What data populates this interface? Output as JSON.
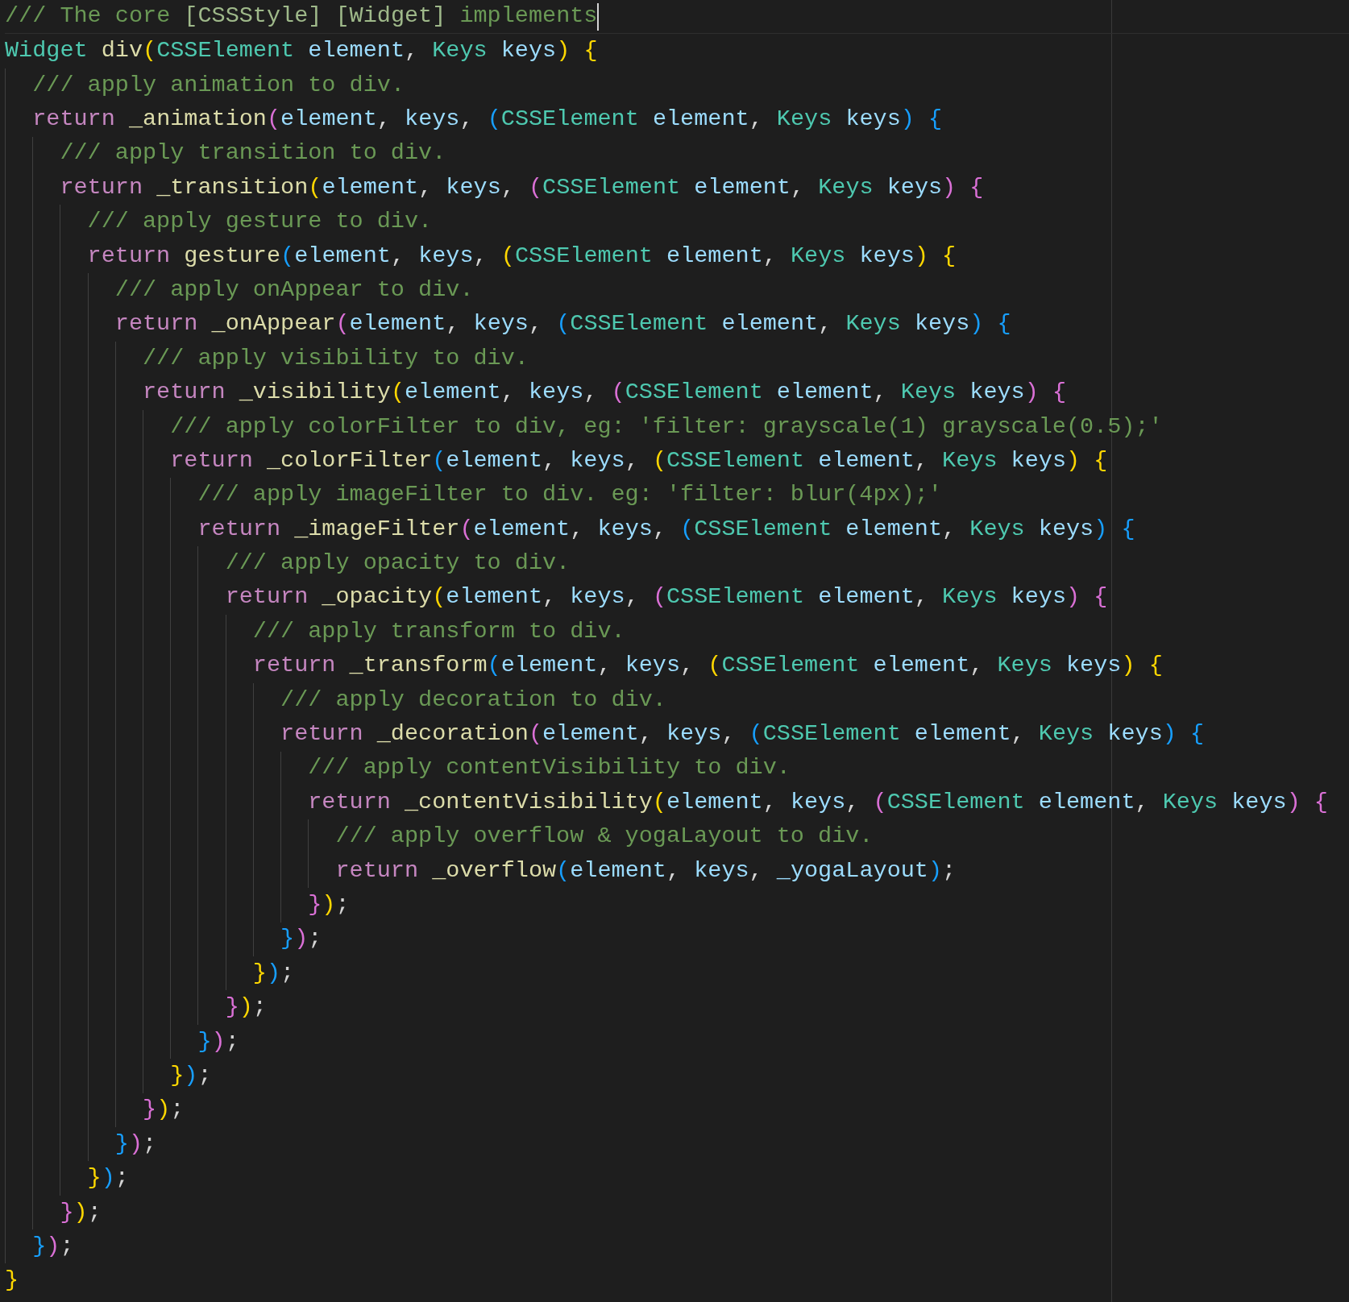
{
  "editor": {
    "lines": [
      {
        "cursor": true,
        "tokens": [
          {
            "text": "/// The core ",
            "kind": "comment"
          },
          {
            "text": "[CSSStyle]",
            "kind": "docref"
          },
          {
            "text": " [Widget]",
            "kind": "docref"
          },
          {
            "text": " implements",
            "kind": "comment"
          }
        ]
      },
      {
        "cursor": false,
        "tokens": [
          {
            "text": "Widget ",
            "kind": "type"
          },
          {
            "text": "div",
            "kind": "fn"
          },
          {
            "text": "(",
            "kind": "b0"
          },
          {
            "text": "CSSElement",
            "kind": "type"
          },
          {
            "text": " element",
            "kind": "var"
          },
          {
            "text": ", ",
            "kind": "punct"
          },
          {
            "text": "Keys",
            "kind": "type"
          },
          {
            "text": " keys",
            "kind": "var"
          },
          {
            "text": ")",
            "kind": "b0"
          },
          {
            "text": " {",
            "kind": "b0"
          }
        ]
      },
      {
        "cursor": false,
        "tokens": [
          {
            "text": "  /// apply animation to div.",
            "kind": "comment"
          }
        ]
      },
      {
        "cursor": false,
        "tokens": [
          {
            "text": "  return ",
            "kind": "keyword"
          },
          {
            "text": "_animation",
            "kind": "fn"
          },
          {
            "text": "(",
            "kind": "b1"
          },
          {
            "text": "element",
            "kind": "var"
          },
          {
            "text": ", ",
            "kind": "punct"
          },
          {
            "text": "keys",
            "kind": "var"
          },
          {
            "text": ", ",
            "kind": "punct"
          },
          {
            "text": "(",
            "kind": "b2"
          },
          {
            "text": "CSSElement",
            "kind": "type"
          },
          {
            "text": " element",
            "kind": "var"
          },
          {
            "text": ", ",
            "kind": "punct"
          },
          {
            "text": "Keys",
            "kind": "type"
          },
          {
            "text": " keys",
            "kind": "var"
          },
          {
            "text": ")",
            "kind": "b2"
          },
          {
            "text": " {",
            "kind": "b2"
          }
        ]
      },
      {
        "cursor": false,
        "tokens": [
          {
            "text": "    /// apply transition to div.",
            "kind": "comment"
          }
        ]
      },
      {
        "cursor": false,
        "tokens": [
          {
            "text": "    return ",
            "kind": "keyword"
          },
          {
            "text": "_transition",
            "kind": "fn"
          },
          {
            "text": "(",
            "kind": "b0"
          },
          {
            "text": "element",
            "kind": "var"
          },
          {
            "text": ", ",
            "kind": "punct"
          },
          {
            "text": "keys",
            "kind": "var"
          },
          {
            "text": ", ",
            "kind": "punct"
          },
          {
            "text": "(",
            "kind": "b1"
          },
          {
            "text": "CSSElement",
            "kind": "type"
          },
          {
            "text": " element",
            "kind": "var"
          },
          {
            "text": ", ",
            "kind": "punct"
          },
          {
            "text": "Keys",
            "kind": "type"
          },
          {
            "text": " keys",
            "kind": "var"
          },
          {
            "text": ")",
            "kind": "b1"
          },
          {
            "text": " {",
            "kind": "b1"
          }
        ]
      },
      {
        "cursor": false,
        "tokens": [
          {
            "text": "      /// apply gesture to div.",
            "kind": "comment"
          }
        ]
      },
      {
        "cursor": false,
        "tokens": [
          {
            "text": "      return ",
            "kind": "keyword"
          },
          {
            "text": "gesture",
            "kind": "fn"
          },
          {
            "text": "(",
            "kind": "b2"
          },
          {
            "text": "element",
            "kind": "var"
          },
          {
            "text": ", ",
            "kind": "punct"
          },
          {
            "text": "keys",
            "kind": "var"
          },
          {
            "text": ", ",
            "kind": "punct"
          },
          {
            "text": "(",
            "kind": "b0"
          },
          {
            "text": "CSSElement",
            "kind": "type"
          },
          {
            "text": " element",
            "kind": "var"
          },
          {
            "text": ", ",
            "kind": "punct"
          },
          {
            "text": "Keys",
            "kind": "type"
          },
          {
            "text": " keys",
            "kind": "var"
          },
          {
            "text": ")",
            "kind": "b0"
          },
          {
            "text": " {",
            "kind": "b0"
          }
        ]
      },
      {
        "cursor": false,
        "tokens": [
          {
            "text": "        /// apply onAppear to div.",
            "kind": "comment"
          }
        ]
      },
      {
        "cursor": false,
        "tokens": [
          {
            "text": "        return ",
            "kind": "keyword"
          },
          {
            "text": "_onAppear",
            "kind": "fn"
          },
          {
            "text": "(",
            "kind": "b1"
          },
          {
            "text": "element",
            "kind": "var"
          },
          {
            "text": ", ",
            "kind": "punct"
          },
          {
            "text": "keys",
            "kind": "var"
          },
          {
            "text": ", ",
            "kind": "punct"
          },
          {
            "text": "(",
            "kind": "b2"
          },
          {
            "text": "CSSElement",
            "kind": "type"
          },
          {
            "text": " element",
            "kind": "var"
          },
          {
            "text": ", ",
            "kind": "punct"
          },
          {
            "text": "Keys",
            "kind": "type"
          },
          {
            "text": " keys",
            "kind": "var"
          },
          {
            "text": ")",
            "kind": "b2"
          },
          {
            "text": " {",
            "kind": "b2"
          }
        ]
      },
      {
        "cursor": false,
        "tokens": [
          {
            "text": "          /// apply visibility to div.",
            "kind": "comment"
          }
        ]
      },
      {
        "cursor": false,
        "tokens": [
          {
            "text": "          return ",
            "kind": "keyword"
          },
          {
            "text": "_visibility",
            "kind": "fn"
          },
          {
            "text": "(",
            "kind": "b0"
          },
          {
            "text": "element",
            "kind": "var"
          },
          {
            "text": ", ",
            "kind": "punct"
          },
          {
            "text": "keys",
            "kind": "var"
          },
          {
            "text": ", ",
            "kind": "punct"
          },
          {
            "text": "(",
            "kind": "b1"
          },
          {
            "text": "CSSElement",
            "kind": "type"
          },
          {
            "text": " element",
            "kind": "var"
          },
          {
            "text": ", ",
            "kind": "punct"
          },
          {
            "text": "Keys",
            "kind": "type"
          },
          {
            "text": " keys",
            "kind": "var"
          },
          {
            "text": ")",
            "kind": "b1"
          },
          {
            "text": " {",
            "kind": "b1"
          }
        ]
      },
      {
        "cursor": false,
        "tokens": [
          {
            "text": "            /// apply colorFilter to div, eg: 'filter: grayscale(1) grayscale(0.5);'",
            "kind": "comment"
          }
        ]
      },
      {
        "cursor": false,
        "tokens": [
          {
            "text": "            return ",
            "kind": "keyword"
          },
          {
            "text": "_colorFilter",
            "kind": "fn"
          },
          {
            "text": "(",
            "kind": "b2"
          },
          {
            "text": "element",
            "kind": "var"
          },
          {
            "text": ", ",
            "kind": "punct"
          },
          {
            "text": "keys",
            "kind": "var"
          },
          {
            "text": ", ",
            "kind": "punct"
          },
          {
            "text": "(",
            "kind": "b0"
          },
          {
            "text": "CSSElement",
            "kind": "type"
          },
          {
            "text": " element",
            "kind": "var"
          },
          {
            "text": ", ",
            "kind": "punct"
          },
          {
            "text": "Keys",
            "kind": "type"
          },
          {
            "text": " keys",
            "kind": "var"
          },
          {
            "text": ")",
            "kind": "b0"
          },
          {
            "text": " {",
            "kind": "b0"
          }
        ]
      },
      {
        "cursor": false,
        "tokens": [
          {
            "text": "              /// apply imageFilter to div. eg: 'filter: blur(4px);'",
            "kind": "comment"
          }
        ]
      },
      {
        "cursor": false,
        "tokens": [
          {
            "text": "              return ",
            "kind": "keyword"
          },
          {
            "text": "_imageFilter",
            "kind": "fn"
          },
          {
            "text": "(",
            "kind": "b1"
          },
          {
            "text": "element",
            "kind": "var"
          },
          {
            "text": ", ",
            "kind": "punct"
          },
          {
            "text": "keys",
            "kind": "var"
          },
          {
            "text": ", ",
            "kind": "punct"
          },
          {
            "text": "(",
            "kind": "b2"
          },
          {
            "text": "CSSElement",
            "kind": "type"
          },
          {
            "text": " element",
            "kind": "var"
          },
          {
            "text": ", ",
            "kind": "punct"
          },
          {
            "text": "Keys",
            "kind": "type"
          },
          {
            "text": " keys",
            "kind": "var"
          },
          {
            "text": ")",
            "kind": "b2"
          },
          {
            "text": " {",
            "kind": "b2"
          }
        ]
      },
      {
        "cursor": false,
        "tokens": [
          {
            "text": "                /// apply opacity to div.",
            "kind": "comment"
          }
        ]
      },
      {
        "cursor": false,
        "tokens": [
          {
            "text": "                return ",
            "kind": "keyword"
          },
          {
            "text": "_opacity",
            "kind": "fn"
          },
          {
            "text": "(",
            "kind": "b0"
          },
          {
            "text": "element",
            "kind": "var"
          },
          {
            "text": ", ",
            "kind": "punct"
          },
          {
            "text": "keys",
            "kind": "var"
          },
          {
            "text": ", ",
            "kind": "punct"
          },
          {
            "text": "(",
            "kind": "b1"
          },
          {
            "text": "CSSElement",
            "kind": "type"
          },
          {
            "text": " element",
            "kind": "var"
          },
          {
            "text": ", ",
            "kind": "punct"
          },
          {
            "text": "Keys",
            "kind": "type"
          },
          {
            "text": " keys",
            "kind": "var"
          },
          {
            "text": ")",
            "kind": "b1"
          },
          {
            "text": " {",
            "kind": "b1"
          }
        ]
      },
      {
        "cursor": false,
        "tokens": [
          {
            "text": "                  /// apply transform to div.",
            "kind": "comment"
          }
        ]
      },
      {
        "cursor": false,
        "tokens": [
          {
            "text": "                  return ",
            "kind": "keyword"
          },
          {
            "text": "_transform",
            "kind": "fn"
          },
          {
            "text": "(",
            "kind": "b2"
          },
          {
            "text": "element",
            "kind": "var"
          },
          {
            "text": ", ",
            "kind": "punct"
          },
          {
            "text": "keys",
            "kind": "var"
          },
          {
            "text": ", ",
            "kind": "punct"
          },
          {
            "text": "(",
            "kind": "b0"
          },
          {
            "text": "CSSElement",
            "kind": "type"
          },
          {
            "text": " element",
            "kind": "var"
          },
          {
            "text": ", ",
            "kind": "punct"
          },
          {
            "text": "Keys",
            "kind": "type"
          },
          {
            "text": " keys",
            "kind": "var"
          },
          {
            "text": ")",
            "kind": "b0"
          },
          {
            "text": " {",
            "kind": "b0"
          }
        ]
      },
      {
        "cursor": false,
        "tokens": [
          {
            "text": "                    /// apply decoration to div.",
            "kind": "comment"
          }
        ]
      },
      {
        "cursor": false,
        "tokens": [
          {
            "text": "                    return ",
            "kind": "keyword"
          },
          {
            "text": "_decoration",
            "kind": "fn"
          },
          {
            "text": "(",
            "kind": "b1"
          },
          {
            "text": "element",
            "kind": "var"
          },
          {
            "text": ", ",
            "kind": "punct"
          },
          {
            "text": "keys",
            "kind": "var"
          },
          {
            "text": ", ",
            "kind": "punct"
          },
          {
            "text": "(",
            "kind": "b2"
          },
          {
            "text": "CSSElement",
            "kind": "type"
          },
          {
            "text": " element",
            "kind": "var"
          },
          {
            "text": ", ",
            "kind": "punct"
          },
          {
            "text": "Keys",
            "kind": "type"
          },
          {
            "text": " keys",
            "kind": "var"
          },
          {
            "text": ")",
            "kind": "b2"
          },
          {
            "text": " {",
            "kind": "b2"
          }
        ]
      },
      {
        "cursor": false,
        "tokens": [
          {
            "text": "                      /// apply contentVisibility to div.",
            "kind": "comment"
          }
        ]
      },
      {
        "cursor": false,
        "tokens": [
          {
            "text": "                      return ",
            "kind": "keyword"
          },
          {
            "text": "_contentVisibility",
            "kind": "fn"
          },
          {
            "text": "(",
            "kind": "b0"
          },
          {
            "text": "element",
            "kind": "var"
          },
          {
            "text": ", ",
            "kind": "punct"
          },
          {
            "text": "keys",
            "kind": "var"
          },
          {
            "text": ", ",
            "kind": "punct"
          },
          {
            "text": "(",
            "kind": "b1"
          },
          {
            "text": "CSSElement",
            "kind": "type"
          },
          {
            "text": " element",
            "kind": "var"
          },
          {
            "text": ", ",
            "kind": "punct"
          },
          {
            "text": "Keys",
            "kind": "type"
          },
          {
            "text": " keys",
            "kind": "var"
          },
          {
            "text": ")",
            "kind": "b1"
          },
          {
            "text": " {",
            "kind": "b1"
          }
        ]
      },
      {
        "cursor": false,
        "tokens": [
          {
            "text": "                        /// apply overflow & yogaLayout to div.",
            "kind": "comment"
          }
        ]
      },
      {
        "cursor": false,
        "tokens": [
          {
            "text": "                        return ",
            "kind": "keyword"
          },
          {
            "text": "_overflow",
            "kind": "fn"
          },
          {
            "text": "(",
            "kind": "b2"
          },
          {
            "text": "element",
            "kind": "var"
          },
          {
            "text": ", ",
            "kind": "punct"
          },
          {
            "text": "keys",
            "kind": "var"
          },
          {
            "text": ", ",
            "kind": "punct"
          },
          {
            "text": "_yogaLayout",
            "kind": "var"
          },
          {
            "text": ")",
            "kind": "b2"
          },
          {
            "text": ";",
            "kind": "punct"
          }
        ]
      },
      {
        "cursor": false,
        "tokens": [
          {
            "text": "                      }",
            "kind": "b1"
          },
          {
            "text": ")",
            "kind": "b0"
          },
          {
            "text": ";",
            "kind": "punct"
          }
        ]
      },
      {
        "cursor": false,
        "tokens": [
          {
            "text": "                    }",
            "kind": "b2"
          },
          {
            "text": ")",
            "kind": "b1"
          },
          {
            "text": ";",
            "kind": "punct"
          }
        ]
      },
      {
        "cursor": false,
        "tokens": [
          {
            "text": "                  }",
            "kind": "b0"
          },
          {
            "text": ")",
            "kind": "b2"
          },
          {
            "text": ";",
            "kind": "punct"
          }
        ]
      },
      {
        "cursor": false,
        "tokens": [
          {
            "text": "                }",
            "kind": "b1"
          },
          {
            "text": ")",
            "kind": "b0"
          },
          {
            "text": ";",
            "kind": "punct"
          }
        ]
      },
      {
        "cursor": false,
        "tokens": [
          {
            "text": "              }",
            "kind": "b2"
          },
          {
            "text": ")",
            "kind": "b1"
          },
          {
            "text": ";",
            "kind": "punct"
          }
        ]
      },
      {
        "cursor": false,
        "tokens": [
          {
            "text": "            }",
            "kind": "b0"
          },
          {
            "text": ")",
            "kind": "b2"
          },
          {
            "text": ";",
            "kind": "punct"
          }
        ]
      },
      {
        "cursor": false,
        "tokens": [
          {
            "text": "          }",
            "kind": "b1"
          },
          {
            "text": ")",
            "kind": "b0"
          },
          {
            "text": ";",
            "kind": "punct"
          }
        ]
      },
      {
        "cursor": false,
        "tokens": [
          {
            "text": "        }",
            "kind": "b2"
          },
          {
            "text": ")",
            "kind": "b1"
          },
          {
            "text": ";",
            "kind": "punct"
          }
        ]
      },
      {
        "cursor": false,
        "tokens": [
          {
            "text": "      }",
            "kind": "b0"
          },
          {
            "text": ")",
            "kind": "b2"
          },
          {
            "text": ";",
            "kind": "punct"
          }
        ]
      },
      {
        "cursor": false,
        "tokens": [
          {
            "text": "    }",
            "kind": "b1"
          },
          {
            "text": ")",
            "kind": "b0"
          },
          {
            "text": ";",
            "kind": "punct"
          }
        ]
      },
      {
        "cursor": false,
        "tokens": [
          {
            "text": "  }",
            "kind": "b2"
          },
          {
            "text": ")",
            "kind": "b1"
          },
          {
            "text": ";",
            "kind": "punct"
          }
        ]
      },
      {
        "cursor": false,
        "tokens": [
          {
            "text": "}",
            "kind": "b0"
          }
        ]
      }
    ]
  }
}
